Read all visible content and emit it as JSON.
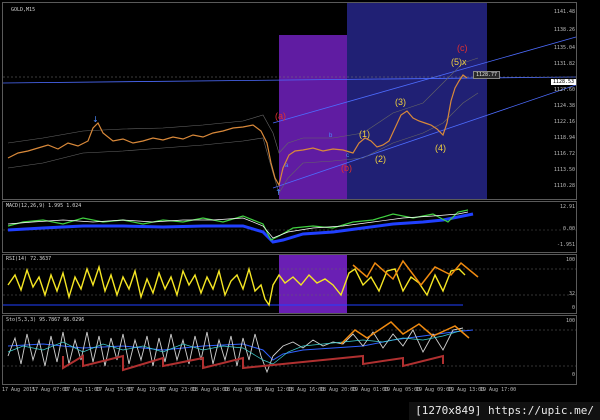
{
  "symbol": "GOLD,M15",
  "main": {
    "price_ticks": [
      "1141.48",
      "1138.26",
      "1135.04",
      "1131.82",
      "1127.60",
      "1124.38",
      "1122.16",
      "1118.94",
      "1116.72",
      "1113.50",
      "1110.28"
    ],
    "current_price_left": "1128.77",
    "current_price_right": "1128.53",
    "labels": {
      "a_red": "(a)",
      "b_red": "(b)",
      "c_red": "(c)",
      "w1": "(1)",
      "w2": "(2)",
      "w3": "(3)",
      "w4": "(4)",
      "w5": "(5)x",
      "small_a": "a",
      "small_b": "b",
      "small_c": "c"
    }
  },
  "macd": {
    "title": "MACD(12,26,9) 1.995 1.024",
    "ticks": [
      "12.91",
      "0.00",
      "-1.951"
    ]
  },
  "rsi": {
    "title": "RSI(14) 72.3637",
    "ticks": [
      "100",
      "32",
      "0"
    ]
  },
  "stoch": {
    "title": "Sto(5,3,3) 95.7867 86.0296",
    "ticks": [
      "100",
      "0"
    ]
  },
  "time_axis": [
    "17 Aug 2015",
    "17 Aug 07:00",
    "17 Aug 11:00",
    "17 Aug 15:00",
    "17 Aug 19:00",
    "17 Aug 23:00",
    "18 Aug 04:00",
    "18 Aug 08:00",
    "18 Aug 12:00",
    "18 Aug 16:00",
    "18 Aug 20:00",
    "19 Aug 01:00",
    "19 Aug 05:00",
    "19 Aug 09:00",
    "19 Aug 13:00",
    "19 Aug 17:00"
  ],
  "footer": "[1270x849] https://upic.me/",
  "colors": {
    "purple": "#6a1fb4",
    "navy": "#22227a",
    "wave_red": "#e03030",
    "wave_yellow": "#f0d040",
    "orange": "#f08a10",
    "grid": "#5a5a5a"
  }
}
